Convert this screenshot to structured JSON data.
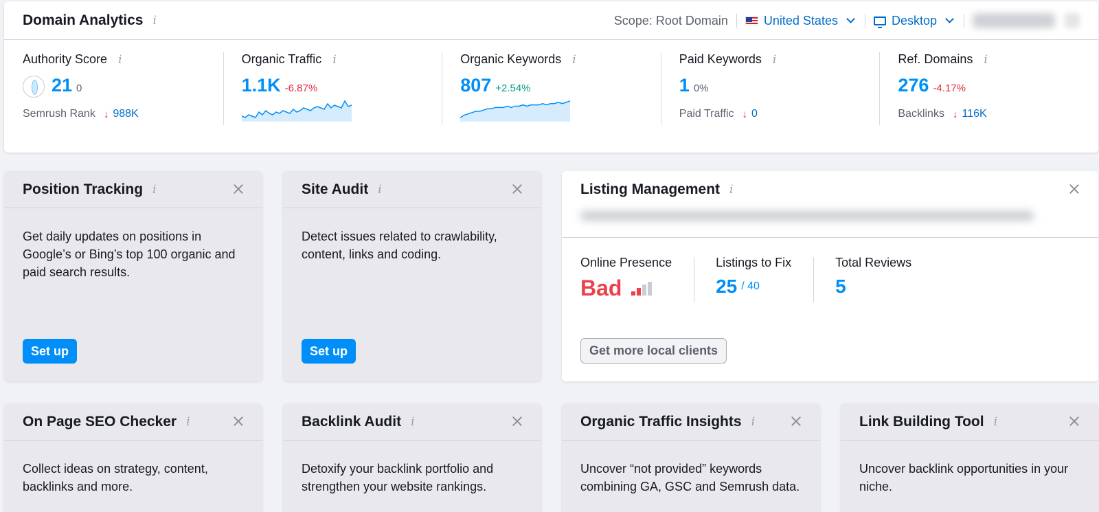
{
  "domain_analytics": {
    "title": "Domain Analytics",
    "scope": "Scope: Root Domain",
    "country": "United States",
    "device": "Desktop"
  },
  "metrics": [
    {
      "label": "Authority Score",
      "value": "21",
      "sub": "0",
      "foot_label": "Semrush Rank",
      "foot_value": "988K"
    },
    {
      "label": "Organic Traffic",
      "value": "1.1K",
      "sub": "-6.87%",
      "sparkline": [
        3,
        2,
        4,
        3,
        2,
        6,
        4,
        7,
        5,
        4,
        6,
        5,
        7,
        6,
        5,
        8,
        6,
        7,
        9,
        8,
        7,
        9,
        10,
        9,
        8,
        12,
        9,
        11,
        10,
        9,
        14,
        10,
        11
      ]
    },
    {
      "label": "Organic Keywords",
      "value": "807",
      "sub": "+2.54%",
      "sparkline": [
        2,
        4,
        5,
        6,
        7,
        7,
        8,
        9,
        9,
        10,
        10,
        10,
        11,
        10,
        11,
        11,
        12,
        11,
        12,
        12,
        12,
        13,
        12,
        13,
        13,
        14,
        13,
        14,
        15
      ]
    },
    {
      "label": "Paid Keywords",
      "value": "1",
      "sub": "0%",
      "foot_label": "Paid Traffic",
      "foot_value": "0"
    },
    {
      "label": "Ref. Domains",
      "value": "276",
      "sub": "-4.17%",
      "foot_label": "Backlinks",
      "foot_value": "116K"
    }
  ],
  "cards": {
    "position_tracking": {
      "title": "Position Tracking",
      "body": "Get daily updates on positions in Google’s or Bing’s top 100 organic and paid search results.",
      "button": "Set up"
    },
    "site_audit": {
      "title": "Site Audit",
      "body": "Detect issues related to crawlability, content, links and coding.",
      "button": "Set up"
    },
    "listing_management": {
      "title": "Listing Management",
      "online_presence_label": "Online Presence",
      "online_presence_value": "Bad",
      "listings_label": "Listings to Fix",
      "listings_value": "25",
      "listings_total": "/ 40",
      "reviews_label": "Total Reviews",
      "reviews_value": "5",
      "button": "Get more local clients"
    },
    "on_page_seo": {
      "title": "On Page SEO Checker",
      "body": "Collect ideas on strategy, content, backlinks and more."
    },
    "backlink_audit": {
      "title": "Backlink Audit",
      "body": "Detoxify your backlink portfolio and strengthen your website rankings."
    },
    "organic_insights": {
      "title": "Organic Traffic Insights",
      "body": "Uncover “not provided” keywords combining GA, GSC and Semrush data."
    },
    "link_building": {
      "title": "Link Building Tool",
      "body": "Uncover backlink opportunities in your niche."
    }
  },
  "colors": {
    "accent": "#008ff8",
    "negative": "#e5293f",
    "positive": "#009f81",
    "bad": "#ee3f4b"
  }
}
